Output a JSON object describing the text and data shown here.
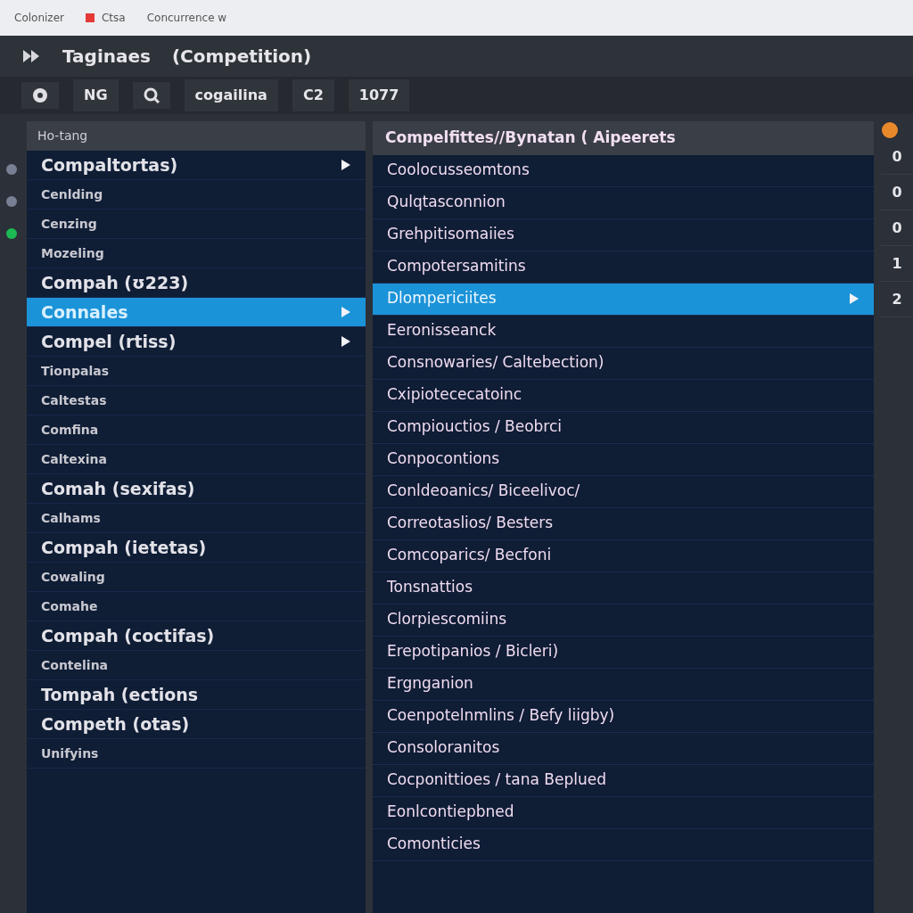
{
  "browser_bar": {
    "tabs": [
      {
        "label": "Colonizer",
        "kind": "plain"
      },
      {
        "label": "Ctsa",
        "kind": "flagged"
      },
      {
        "label": "Concurrence w",
        "kind": "plain"
      }
    ]
  },
  "title_bar": {
    "app_name": "Taginaes",
    "document": "(Competition)"
  },
  "toolbar": {
    "items": [
      {
        "kind": "record"
      },
      {
        "kind": "text",
        "label": "NG"
      },
      {
        "kind": "search"
      },
      {
        "kind": "text",
        "label": "cogailina"
      },
      {
        "kind": "text",
        "label": "C2"
      },
      {
        "kind": "text",
        "label": "1077"
      }
    ]
  },
  "status_dots": [
    {
      "color": "#7a8094"
    },
    {
      "color": "#7a8094"
    },
    {
      "color": "#1db954"
    }
  ],
  "left_panel": {
    "header": "Ho-tang",
    "items": [
      {
        "label": "Compaltortas)",
        "kind": "group",
        "selected": false,
        "has_arrow": true
      },
      {
        "label": "Cenlding",
        "kind": "item",
        "selected": false,
        "has_arrow": false
      },
      {
        "label": "Cenzing",
        "kind": "item",
        "selected": false,
        "has_arrow": false
      },
      {
        "label": "Mozeling",
        "kind": "item",
        "selected": false,
        "has_arrow": false
      },
      {
        "label": "Compah (ʊ223)",
        "kind": "group",
        "selected": false,
        "has_arrow": false
      },
      {
        "label": "Connales",
        "kind": "group",
        "selected": true,
        "has_arrow": true
      },
      {
        "label": "Compel (rtiss)",
        "kind": "group",
        "selected": false,
        "has_arrow": true
      },
      {
        "label": "Tionpalas",
        "kind": "item",
        "selected": false,
        "has_arrow": false
      },
      {
        "label": "Caltestas",
        "kind": "item",
        "selected": false,
        "has_arrow": false
      },
      {
        "label": "Comfina",
        "kind": "item",
        "selected": false,
        "has_arrow": false
      },
      {
        "label": "Caltexina",
        "kind": "item",
        "selected": false,
        "has_arrow": false
      },
      {
        "label": "Comah (sexifas)",
        "kind": "group",
        "selected": false,
        "has_arrow": false
      },
      {
        "label": "Calhams",
        "kind": "item",
        "selected": false,
        "has_arrow": false
      },
      {
        "label": "Compah (ietetas)",
        "kind": "group",
        "selected": false,
        "has_arrow": false
      },
      {
        "label": "Cowaling",
        "kind": "item",
        "selected": false,
        "has_arrow": false
      },
      {
        "label": "Comahe",
        "kind": "item",
        "selected": false,
        "has_arrow": false
      },
      {
        "label": "Compah (coctifas)",
        "kind": "group",
        "selected": false,
        "has_arrow": false
      },
      {
        "label": "Contelina",
        "kind": "item",
        "selected": false,
        "has_arrow": false
      },
      {
        "label": "Tompah (ections",
        "kind": "group",
        "selected": false,
        "has_arrow": false
      },
      {
        "label": "Competh (otas)",
        "kind": "group",
        "selected": false,
        "has_arrow": false
      },
      {
        "label": "Unifyins",
        "kind": "item",
        "selected": false,
        "has_arrow": false
      }
    ]
  },
  "middle_panel": {
    "header": "Compelfittes//Bynatan ( Aipeerets",
    "items": [
      {
        "label": "Coolocusseomtons",
        "selected": false,
        "has_arrow": false
      },
      {
        "label": "Qulqtasconnion",
        "selected": false,
        "has_arrow": false
      },
      {
        "label": "Grehpitisomaiies",
        "selected": false,
        "has_arrow": false
      },
      {
        "label": "Compotersamitins",
        "selected": false,
        "has_arrow": false
      },
      {
        "label": "Dlompericiites",
        "selected": true,
        "has_arrow": true
      },
      {
        "label": "Eeronisseanck",
        "selected": false,
        "has_arrow": false
      },
      {
        "label": "Consnowaries/ Caltebection)",
        "selected": false,
        "has_arrow": false
      },
      {
        "label": "Cxipiotececatoinc",
        "selected": false,
        "has_arrow": false
      },
      {
        "label": "Compiouctios / Beobrci",
        "selected": false,
        "has_arrow": false
      },
      {
        "label": "Conpocontions",
        "selected": false,
        "has_arrow": false
      },
      {
        "label": "Conldeoanics/ Biceelivoc/",
        "selected": false,
        "has_arrow": false
      },
      {
        "label": "Correotaslios/ Besters",
        "selected": false,
        "has_arrow": false
      },
      {
        "label": "Comcoparics/ Becfoni",
        "selected": false,
        "has_arrow": false
      },
      {
        "label": "Tonsnattios",
        "selected": false,
        "has_arrow": false
      },
      {
        "label": "Clorpiescomiins",
        "selected": false,
        "has_arrow": false
      },
      {
        "label": "Erepotipanios / Bicleri)",
        "selected": false,
        "has_arrow": false
      },
      {
        "label": "Ergnganion",
        "selected": false,
        "has_arrow": false
      },
      {
        "label": "Coenpotelnmlins / Befy liigby)",
        "selected": false,
        "has_arrow": false
      },
      {
        "label": "Consoloranitos",
        "selected": false,
        "has_arrow": false
      },
      {
        "label": "Cocponittioes / tana Beplued",
        "selected": false,
        "has_arrow": false
      },
      {
        "label": "Eonlcontiepbned",
        "selected": false,
        "has_arrow": false
      },
      {
        "label": "Comonticies",
        "selected": false,
        "has_arrow": false
      }
    ]
  },
  "right_column": {
    "values": [
      "0",
      "0",
      "0",
      "1",
      "2"
    ]
  }
}
